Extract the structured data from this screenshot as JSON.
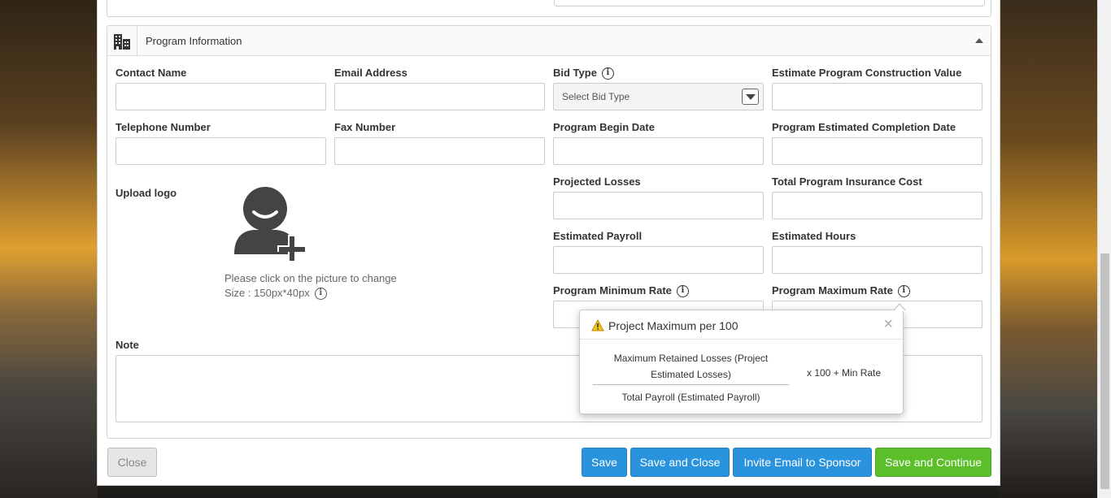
{
  "section": {
    "title": "Program Information"
  },
  "fields": {
    "contact_name": "Contact Name",
    "email_address": "Email Address",
    "bid_type": "Bid Type",
    "bid_type_placeholder": "Select Bid Type",
    "estimate_construction_value": "Estimate Program Construction Value",
    "telephone_number": "Telephone Number",
    "fax_number": "Fax Number",
    "program_begin_date": "Program Begin Date",
    "program_completion_date": "Program Estimated Completion Date",
    "upload_logo": "Upload logo",
    "projected_losses": "Projected Losses",
    "total_insurance_cost": "Total Program Insurance Cost",
    "estimated_payroll": "Estimated Payroll",
    "estimated_hours": "Estimated Hours",
    "program_minimum_rate": "Program Minimum Rate",
    "program_maximum_rate": "Program Maximum Rate",
    "note": "Note"
  },
  "upload": {
    "hint": "Please click on the picture to change",
    "size": "Size : 150px*40px"
  },
  "popover": {
    "title": "Project Maximum per 100",
    "numerator_line1": "Maximum Retained Losses (Project",
    "numerator_line2": "Estimated Losses)",
    "denominator": "Total Payroll (Estimated Payroll)",
    "multiplier": "x 100 + Min Rate",
    "close": "×"
  },
  "buttons": {
    "close": "Close",
    "save": "Save",
    "save_and_close": "Save and Close",
    "invite_email": "Invite Email to Sponsor",
    "save_and_continue": "Save and Continue"
  },
  "colors": {
    "primary": "#2a93dd",
    "success": "#5cbf2a",
    "warning": "#f0c419"
  },
  "icons": {
    "section": "building-icon",
    "upload": "add-user-icon",
    "info": "info-icon",
    "warning": "warning-icon",
    "collapse": "caret-up-icon"
  }
}
